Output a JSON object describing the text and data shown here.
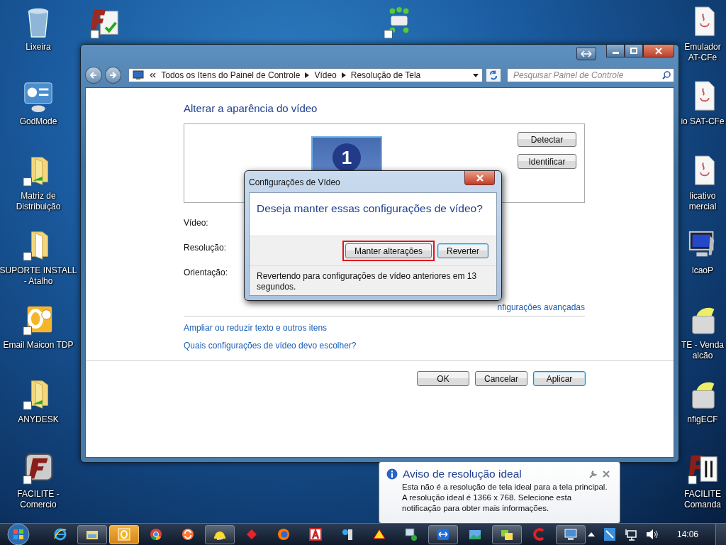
{
  "desktop": {
    "top_icons": [
      {
        "kind": "facilite-doc"
      },
      {
        "kind": "ib"
      }
    ],
    "left_icons": [
      {
        "kind": "recycle-bin",
        "lines": [
          "Lixeira"
        ]
      },
      {
        "kind": "control-panel",
        "lines": [
          "GodMode"
        ]
      },
      {
        "kind": "folder-link",
        "lines": [
          "Matriz de",
          "Distribuição"
        ]
      },
      {
        "kind": "folder",
        "lines": [
          "SUPORTE INSTALL",
          "- Atalho"
        ]
      },
      {
        "kind": "outlook",
        "lines": [
          "Email Maicon TDP"
        ]
      },
      {
        "kind": "folder-link",
        "lines": [
          "ANYDESK"
        ]
      },
      {
        "kind": "facilite",
        "lines": [
          "FACILITE -",
          "Comercio"
        ]
      }
    ],
    "right_icons": [
      {
        "kind": "java-doc",
        "lines": [
          "Emulador",
          "AT-CFe"
        ]
      },
      {
        "kind": "java-doc",
        "lines": [
          "io SAT-CFe"
        ]
      },
      {
        "kind": "java-doc",
        "lines": [
          "licativo",
          "mercial"
        ]
      },
      {
        "kind": "monitor-tool",
        "lines": [
          "lcaoP"
        ]
      },
      {
        "kind": "ecf-printer",
        "lines": [
          "TE - Venda",
          "alcão"
        ]
      },
      {
        "kind": "ecf-printer",
        "lines": [
          "nfigECF"
        ]
      },
      {
        "kind": "facilite-comanda",
        "lines": [
          "FACILITE",
          "Comanda"
        ]
      }
    ]
  },
  "window": {
    "crumbs": [
      "Todos os Itens do Painel de Controle",
      "Vídeo",
      "Resolução de Tela"
    ],
    "search": {
      "placeholder": "Pesquisar Painel de Controle"
    },
    "heading": "Alterar a aparência do vídeo",
    "side_buttons": [
      {
        "label": "Detectar"
      },
      {
        "label": "Identificar"
      }
    ],
    "monitor": {
      "number": "1"
    },
    "fields": [
      "Vídeo:",
      "Resolução:",
      "Orientação:"
    ],
    "advanced_link": "nfigurações avançadas",
    "links": [
      "Ampliar ou reduzir texto e outros itens",
      "Quais configurações de vídeo devo escolher?"
    ],
    "buttons": [
      {
        "label": "OK",
        "default": false
      },
      {
        "label": "Cancelar",
        "default": false
      },
      {
        "label": "Aplicar",
        "default": true
      }
    ]
  },
  "dialog": {
    "title": "Configurações de Vídeo",
    "question": "Deseja manter essas configurações de vídeo?",
    "buttons": [
      {
        "label": "Manter alterações",
        "default": false,
        "highlighted": true
      },
      {
        "label": "Reverter",
        "default": true,
        "highlighted": false
      }
    ],
    "message": "Revertendo para configurações de vídeo anteriores em 13 segundos."
  },
  "notification": {
    "title": "Aviso de resolução ideal",
    "body": "Esta não é a resolução de tela ideal para a tela principal. A resolução ideal é 1366 x 768. Selecione esta notificação para obter mais informações."
  },
  "taskbar": {
    "apps": [
      {
        "kind": "ie",
        "open": false,
        "flashing": false
      },
      {
        "kind": "explorer",
        "open": true,
        "flashing": false
      },
      {
        "kind": "outlook",
        "open": true,
        "flashing": true
      },
      {
        "kind": "chrome",
        "open": false,
        "flashing": false
      },
      {
        "kind": "sync",
        "open": false,
        "flashing": false
      },
      {
        "kind": "helmet",
        "open": true,
        "flashing": false
      },
      {
        "kind": "diamond",
        "open": false,
        "flashing": false
      },
      {
        "kind": "firefox",
        "open": false,
        "flashing": false
      },
      {
        "kind": "letter-a",
        "open": false,
        "flashing": false
      },
      {
        "kind": "blue-app",
        "open": false,
        "flashing": false
      },
      {
        "kind": "warning-app",
        "open": false,
        "flashing": false
      },
      {
        "kind": "network-pc",
        "open": false,
        "flashing": false
      },
      {
        "kind": "teamviewer",
        "open": true,
        "flashing": false
      },
      {
        "kind": "photo-app",
        "open": false,
        "flashing": false
      },
      {
        "kind": "windows-app",
        "open": true,
        "flashing": false
      },
      {
        "kind": "ccleaner",
        "open": false,
        "flashing": false
      },
      {
        "kind": "display-app",
        "open": true,
        "flashing": false
      }
    ],
    "clock": "14:06"
  }
}
